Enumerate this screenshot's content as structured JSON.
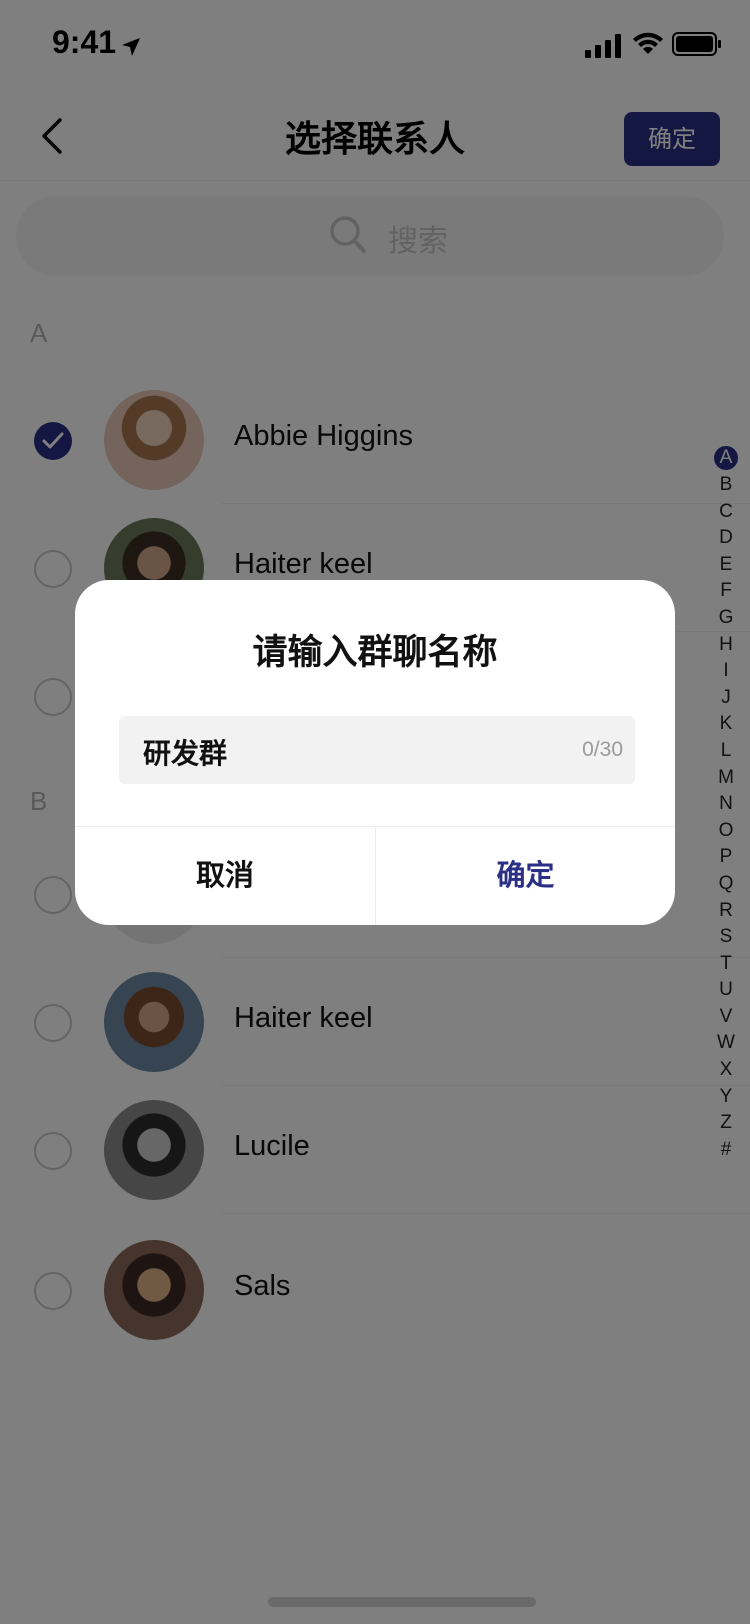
{
  "status_bar": {
    "time": "9:41"
  },
  "nav": {
    "title": "选择联系人",
    "confirm_label": "确定"
  },
  "search": {
    "placeholder": "搜索"
  },
  "sections": [
    {
      "letter": "A",
      "contacts": [
        {
          "name": "Abbie Higgins",
          "selected": true
        },
        {
          "name": "Haiter keel",
          "selected": false
        },
        {
          "name": "",
          "selected": false
        }
      ]
    },
    {
      "letter": "B",
      "contacts": [
        {
          "name": "",
          "selected": false
        },
        {
          "name": "Haiter keel",
          "selected": false
        },
        {
          "name": "Lucile",
          "selected": false
        },
        {
          "name": "Sals",
          "selected": false
        }
      ]
    }
  ],
  "alphabet_index": [
    "A",
    "B",
    "C",
    "D",
    "E",
    "F",
    "G",
    "H",
    "I",
    "J",
    "K",
    "L",
    "M",
    "N",
    "O",
    "P",
    "Q",
    "R",
    "S",
    "T",
    "U",
    "V",
    "W",
    "X",
    "Y",
    "Z",
    "#"
  ],
  "alphabet_active": "A",
  "dialog": {
    "title": "请输入群聊名称",
    "input_value": "研发群",
    "char_count": "0/30",
    "cancel_label": "取消",
    "ok_label": "确定"
  },
  "colors": {
    "accent": "#2b2f86",
    "overlay": "rgba(0,0,0,0.5)"
  }
}
